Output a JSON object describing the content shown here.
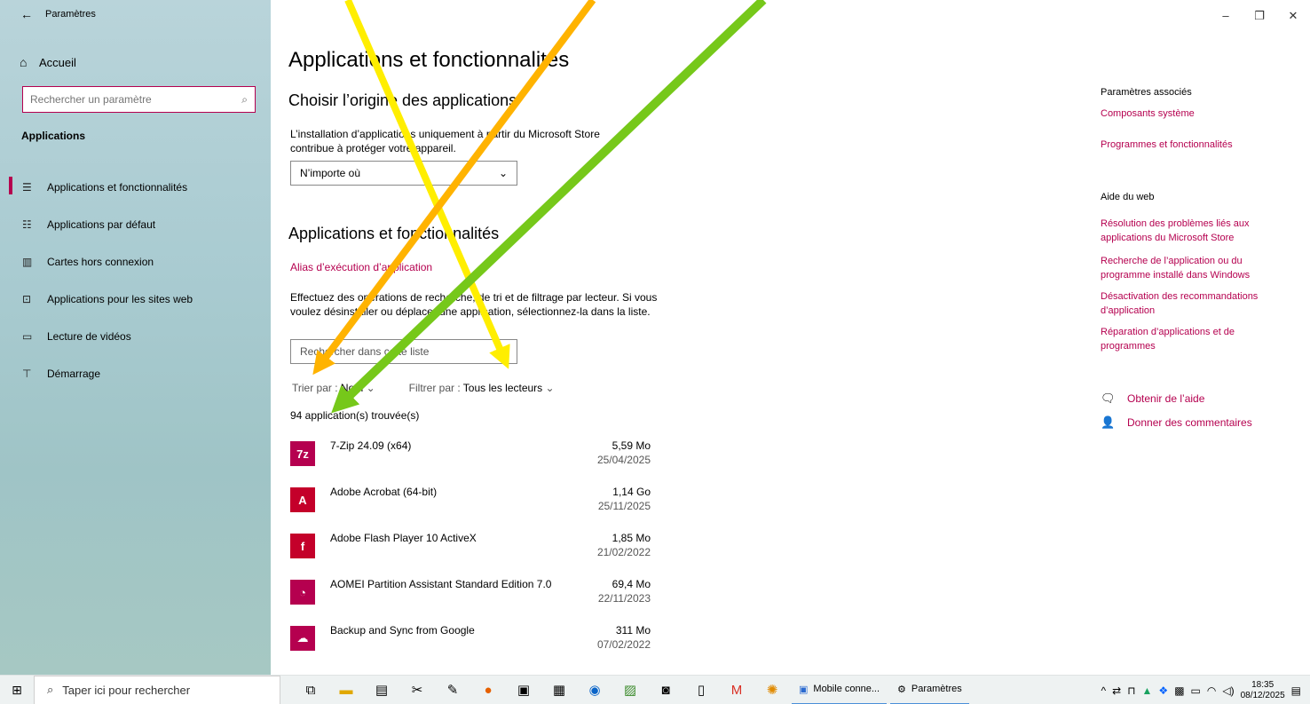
{
  "window": {
    "title": "Paramètres",
    "controls": {
      "minimize": "–",
      "maximize": "❐",
      "close": "✕"
    }
  },
  "sidebar": {
    "home": "Accueil",
    "search_placeholder": "Rechercher un paramètre",
    "section": "Applications",
    "items": [
      {
        "label": "Applications et fonctionnalités",
        "icon": "list-icon",
        "glyph": "☰"
      },
      {
        "label": "Applications par défaut",
        "icon": "default-apps-icon",
        "glyph": "☷"
      },
      {
        "label": "Cartes hors connexion",
        "icon": "map-icon",
        "glyph": "▥"
      },
      {
        "label": "Applications pour les sites web",
        "icon": "web-apps-icon",
        "glyph": "⊡"
      },
      {
        "label": "Lecture de vidéos",
        "icon": "video-icon",
        "glyph": "▭"
      },
      {
        "label": "Démarrage",
        "icon": "startup-icon",
        "glyph": "⊤"
      }
    ]
  },
  "main": {
    "title": "Applications et fonctionnalités",
    "choose_heading": "Choisir l’origine des applications",
    "choose_desc": "L’installation d’applications uniquement à partir du Microsoft Store contribue à protéger votre appareil.",
    "source_select": "N’importe où",
    "apps_heading": "Applications et fonctionnalités",
    "alias_link": "Alias d’exécution d’application",
    "filter_desc": "Effectuez des opérations de recherche, de tri et de filtrage par lecteur. Si vous voulez désinstaller ou déplacer une application, sélectionnez-la dans la liste.",
    "list_search_placeholder": "Rechercher dans cette liste",
    "sort_label": "Trier par :",
    "sort_value": "Nom",
    "filter_label": "Filtrer par :",
    "filter_value": "Tous les lecteurs",
    "count": "94 application(s) trouvée(s)",
    "apps": [
      {
        "name": "7-Zip 24.09 (x64)",
        "size": "5,59 Mo",
        "date": "25/04/2025",
        "glyph": "7z",
        "color": "#b5004f"
      },
      {
        "name": "Adobe Acrobat (64-bit)",
        "size": "1,14 Go",
        "date": "25/11/2025",
        "glyph": "A",
        "color": "#c4002a"
      },
      {
        "name": "Adobe Flash Player 10 ActiveX",
        "size": "1,85 Mo",
        "date": "21/02/2022",
        "glyph": "f",
        "color": "#c4002a"
      },
      {
        "name": "AOMEI Partition Assistant Standard Edition 7.0",
        "size": "69,4 Mo",
        "date": "22/11/2023",
        "glyph": "◔",
        "color": "#b5004f"
      },
      {
        "name": "Backup and Sync from Google",
        "size": "311 Mo",
        "date": "07/02/2022",
        "glyph": "☁",
        "color": "#b5004f"
      }
    ]
  },
  "right": {
    "related_title": "Paramètres associés",
    "related_links": [
      "Composants système",
      "Programmes et fonctionnalités"
    ],
    "web_title": "Aide du web",
    "web_links": [
      "Résolution des problèmes liés aux applications du Microsoft Store",
      "Recherche de l’application ou du programme installé dans Windows",
      "Désactivation des recommandations d’application",
      "Réparation d’applications et de programmes"
    ],
    "get_help": "Obtenir de l’aide",
    "feedback": "Donner des commentaires"
  },
  "taskbar": {
    "search_placeholder": "Taper ici pour rechercher",
    "app_mobile": "Mobile conne...",
    "app_settings": "Paramètres",
    "time": "18:35",
    "date": "08/12/2025"
  },
  "colors": {
    "accent": "#b5004f",
    "arrow_yellow": "#ffee00",
    "arrow_orange": "#ffb300",
    "arrow_green": "#76c81a"
  }
}
